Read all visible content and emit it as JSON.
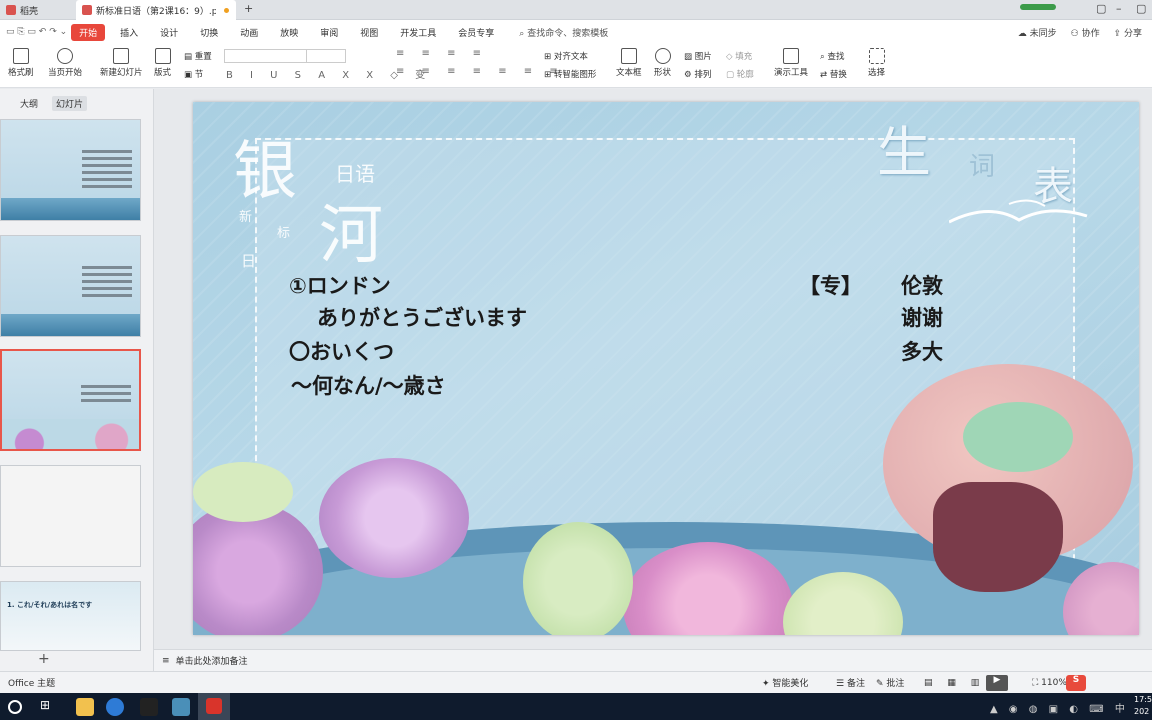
{
  "tabs": [
    {
      "label": "稻壳"
    },
    {
      "label": "新标准日语（第2课16：9）.pptx"
    }
  ],
  "menu": {
    "items": [
      "开始",
      "插入",
      "设计",
      "切换",
      "动画",
      "放映",
      "审阅",
      "视图",
      "开发工具",
      "会员专享"
    ],
    "search": "查找命令、搜索模板",
    "right": [
      "未同步",
      "协作",
      "分享"
    ]
  },
  "ribbon": {
    "format_painter": "格式刷",
    "from_current": "当页开始",
    "new_slide": "新建幻灯片",
    "layout": "版式",
    "section": "节",
    "reset": "重置",
    "align_text": "对齐文本",
    "smartart": "转智能图形",
    "textbox": "文本框",
    "shape": "形状",
    "picture": "图片",
    "arrange": "排列",
    "fill": "填充",
    "outline": "轮廓",
    "presenter": "演示工具",
    "find": "查找",
    "replace": "替换",
    "select": "选择"
  },
  "left_pane": {
    "tab_outline": "大纲",
    "tab_slides": "幻灯片",
    "thumb5_title": "1. これ/それ/あれは名です"
  },
  "slide": {
    "logo_main1": "银",
    "logo_main2": "河",
    "logo_sub": "日语",
    "logo_small1": "新",
    "logo_small2": "标",
    "logo_small3": "日",
    "title_big": "生",
    "title_small": "词",
    "title_tail": "表",
    "rows": [
      {
        "jp": "①ロンドン",
        "tag": "【专】",
        "cn": "伦敦"
      },
      {
        "jp": "ありがとうございます",
        "tag": "",
        "cn": "谢谢"
      },
      {
        "jp": "〇おいくつ",
        "tag": "",
        "cn": "多大"
      },
      {
        "jp": "～何なん/～歳さ",
        "tag": "",
        "cn": ""
      }
    ]
  },
  "notes": {
    "placeholder": "单击此处添加备注"
  },
  "status": {
    "theme": "Office 主题",
    "beautify": "智能美化",
    "notes": "备注",
    "comments": "批注",
    "zoom": "110%"
  },
  "taskbar": {
    "time": "17:5",
    "date": "202"
  }
}
